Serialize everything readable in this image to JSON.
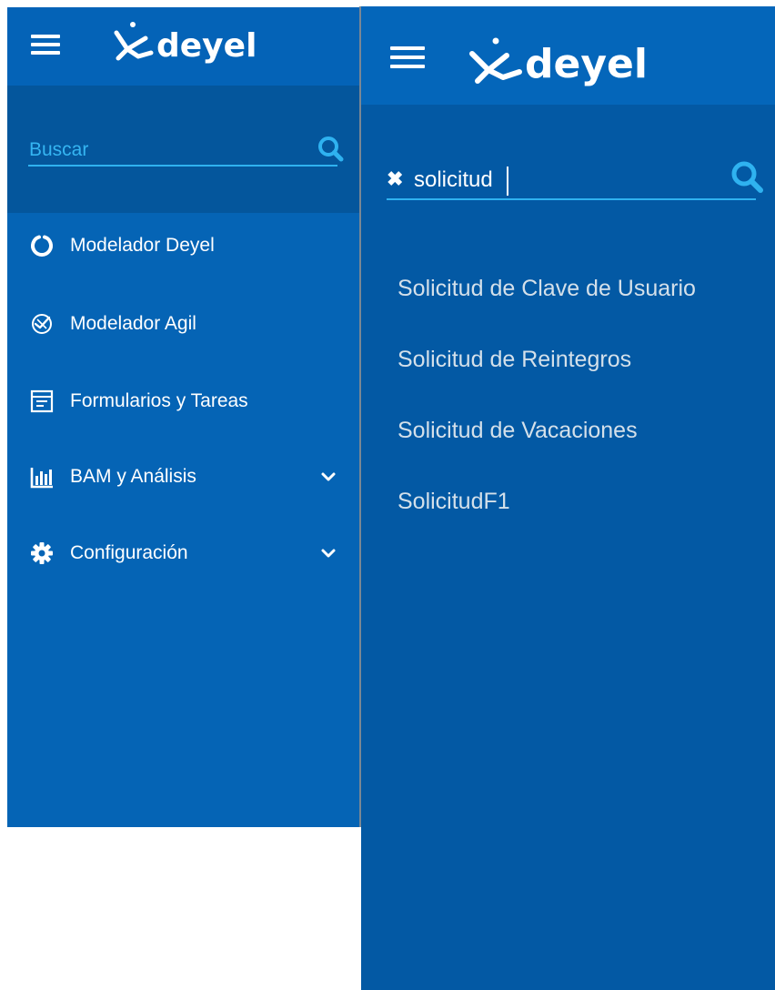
{
  "app": {
    "brand": "deyel"
  },
  "left_panel": {
    "search": {
      "placeholder": "Buscar",
      "value": ""
    },
    "menu": [
      {
        "label": "Modelador Deyel",
        "icon": "circle-notch-icon",
        "has_submenu": false
      },
      {
        "label": "Modelador Agil",
        "icon": "agile-modeler-icon",
        "has_submenu": false
      },
      {
        "label": "Formularios y Tareas",
        "icon": "form-icon",
        "has_submenu": false
      },
      {
        "label": "BAM y Análisis",
        "icon": "bar-chart-icon",
        "has_submenu": true
      },
      {
        "label": "Configuración",
        "icon": "gear-icon",
        "has_submenu": true
      }
    ]
  },
  "right_panel": {
    "search": {
      "value": "solicitud"
    },
    "results": [
      {
        "label": "Solicitud de Clave de Usuario"
      },
      {
        "label": "Solicitud de Reintegros"
      },
      {
        "label": "Solicitud de Vacaciones"
      },
      {
        "label": "SolicitudF1"
      }
    ]
  },
  "colors": {
    "panel_bg": "#0564b5",
    "header_bg": "#0463b7",
    "search_area_bg": "#04569c",
    "accent": "#2fb2f0",
    "result_text": "#d4e0ea"
  }
}
